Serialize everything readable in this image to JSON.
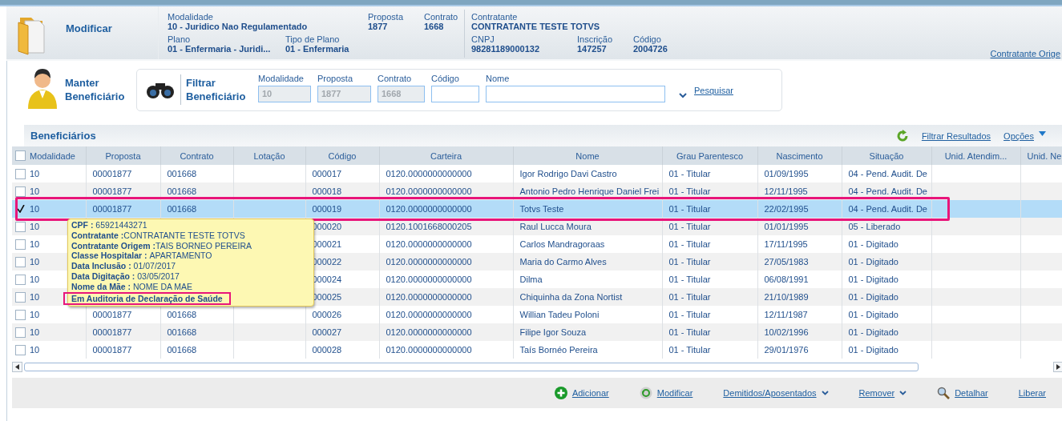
{
  "header": {
    "title": "Modificar",
    "left_fields": [
      {
        "label": "Modalidade",
        "value": "10 - Juridico Nao Regulamentado"
      },
      {
        "label": "Proposta",
        "value": "1877"
      },
      {
        "label": "Contrato",
        "value": "1668"
      },
      {
        "label": "Plano",
        "value": "01 - Enfermaria - Juridi..."
      },
      {
        "label": "Tipo de Plano",
        "value": "01 - Enfermaria"
      }
    ],
    "right_fields": [
      {
        "label": "Contratante",
        "value": "CONTRATANTE TESTE TOTVS"
      },
      {
        "label": "CNPJ",
        "value": "98281189000132"
      },
      {
        "label": "Inscrição",
        "value": "147257"
      },
      {
        "label": "Código",
        "value": "2004726"
      }
    ],
    "link": "Contratante Orige"
  },
  "section": {
    "title_line1": "Manter",
    "title_line2": "Beneficiário"
  },
  "filter": {
    "title_line1": "Filtrar",
    "title_line2": "Beneficiário",
    "fields": [
      {
        "label": "Modalidade",
        "value": "10",
        "disabled": true
      },
      {
        "label": "Proposta",
        "value": "1877",
        "disabled": true
      },
      {
        "label": "Contrato",
        "value": "1668",
        "disabled": true
      },
      {
        "label": "Código",
        "disabled": false
      },
      {
        "label": "Nome",
        "disabled": false
      }
    ],
    "search_link": "Pesquisar"
  },
  "grid": {
    "title": "Beneficiários",
    "filter_link": "Filtrar Resultados",
    "options_link": "Opções",
    "columns": [
      "Modalidade",
      "Proposta",
      "Contrato",
      "Lotação",
      "Código",
      "Carteira",
      "Nome",
      "Grau Parentesco",
      "Nascimento",
      "Situação",
      "Unid. Atendim...",
      "Unid. Ne"
    ],
    "all_checked": false,
    "rows": [
      {
        "checked": false,
        "selected": false,
        "highlighted": false,
        "cells": [
          "10",
          "00001877",
          "001668",
          "",
          "000017",
          "0120.0000000000000",
          "Igor Rodrigo Davi Castro",
          "01 - Titular",
          "01/09/1995",
          "04 - Pend. Audit. De",
          "",
          ""
        ]
      },
      {
        "checked": false,
        "selected": false,
        "highlighted": false,
        "cells": [
          "10",
          "00001877",
          "001668",
          "",
          "000018",
          "0120.0000000000000",
          "Antonio Pedro Henrique Daniel Frei",
          "01 - Titular",
          "12/11/1995",
          "04 - Pend. Audit. De",
          "",
          ""
        ]
      },
      {
        "checked": true,
        "selected": true,
        "highlighted": true,
        "cells": [
          "10",
          "00001877",
          "001668",
          "",
          "000019",
          "0120.0000000000000",
          "Totvs Teste",
          "01 - Titular",
          "22/02/1995",
          "04 - Pend. Audit. De",
          "",
          ""
        ]
      },
      {
        "checked": false,
        "selected": false,
        "highlighted": false,
        "cells": [
          "10",
          "",
          "",
          "",
          "000020",
          "0120.1001668000205",
          "Raul Lucca Moura",
          "01 - Titular",
          "01/01/1995",
          "05 - Liberado",
          "",
          ""
        ]
      },
      {
        "checked": false,
        "selected": false,
        "highlighted": false,
        "cells": [
          "10",
          "",
          "",
          "",
          "000021",
          "0120.0000000000000",
          "Carlos Mandragoraas",
          "01 - Titular",
          "17/11/1995",
          "01 - Digitado",
          "",
          ""
        ]
      },
      {
        "checked": false,
        "selected": false,
        "highlighted": false,
        "cells": [
          "10",
          "",
          "",
          "",
          "000022",
          "0120.0000000000000",
          "Maria do Carmo Alves",
          "01 - Titular",
          "27/05/1983",
          "01 - Digitado",
          "",
          ""
        ]
      },
      {
        "checked": false,
        "selected": false,
        "highlighted": false,
        "cells": [
          "10",
          "",
          "",
          "",
          "000024",
          "0120.0000000000000",
          "Dilma",
          "01 - Titular",
          "06/08/1991",
          "01 - Digitado",
          "",
          ""
        ]
      },
      {
        "checked": false,
        "selected": false,
        "highlighted": false,
        "cells": [
          "10",
          "",
          "",
          "",
          "000025",
          "0120.0000000000000",
          "Chiquinha da Zona Nortist",
          "01 - Titular",
          "21/10/1989",
          "01 - Digitado",
          "",
          ""
        ]
      },
      {
        "checked": false,
        "selected": false,
        "highlighted": false,
        "cells": [
          "10",
          "00001877",
          "001668",
          "",
          "000026",
          "0120.0000000000000",
          "Willian Tadeu Poloni",
          "01 - Titular",
          "12/11/1987",
          "01 - Digitado",
          "",
          ""
        ]
      },
      {
        "checked": false,
        "selected": false,
        "highlighted": false,
        "cells": [
          "10",
          "00001877",
          "001668",
          "",
          "000027",
          "0120.0000000000000",
          "Filipe Igor Souza",
          "01 - Titular",
          "10/02/1996",
          "01 - Digitado",
          "",
          ""
        ]
      },
      {
        "checked": false,
        "selected": false,
        "highlighted": false,
        "cells": [
          "10",
          "00001877",
          "001668",
          "",
          "000028",
          "0120.0000000000000",
          "Taís Bornéo Pereira",
          "01 - Titular",
          "29/01/1976",
          "01 - Digitado",
          "",
          ""
        ]
      }
    ]
  },
  "tooltip": {
    "lines": [
      {
        "label": "CPF : ",
        "value": "65921443271"
      },
      {
        "label": "Contratante :",
        "value": "CONTRATANTE TESTE TOTVS"
      },
      {
        "label": "Contratante Origem :",
        "value": "TAIS BORNEO PEREIRA"
      },
      {
        "label": "Classe Hospitalar : ",
        "value": "APARTAMENTO"
      },
      {
        "label": "Data Inclusão : ",
        "value": "01/07/2017"
      },
      {
        "label": "Data Digitação : ",
        "value": "03/05/2017"
      },
      {
        "label": "Nome da Mãe : ",
        "value": "NOME DA MAE"
      }
    ],
    "note": "Em Auditoria de Declaração de Saúde",
    "note_highlighted": true
  },
  "actions": [
    {
      "label": "Adicionar",
      "kind": "add",
      "dropdown": false
    },
    {
      "label": "Modificar",
      "kind": "modify",
      "dropdown": false
    },
    {
      "label": "Demitidos/Aposentados",
      "kind": "plain",
      "dropdown": true
    },
    {
      "label": "Remover",
      "kind": "plain",
      "dropdown": true
    },
    {
      "label": "Detalhar",
      "kind": "detail",
      "dropdown": false
    },
    {
      "label": "Liberar",
      "kind": "plain",
      "dropdown": false
    }
  ]
}
